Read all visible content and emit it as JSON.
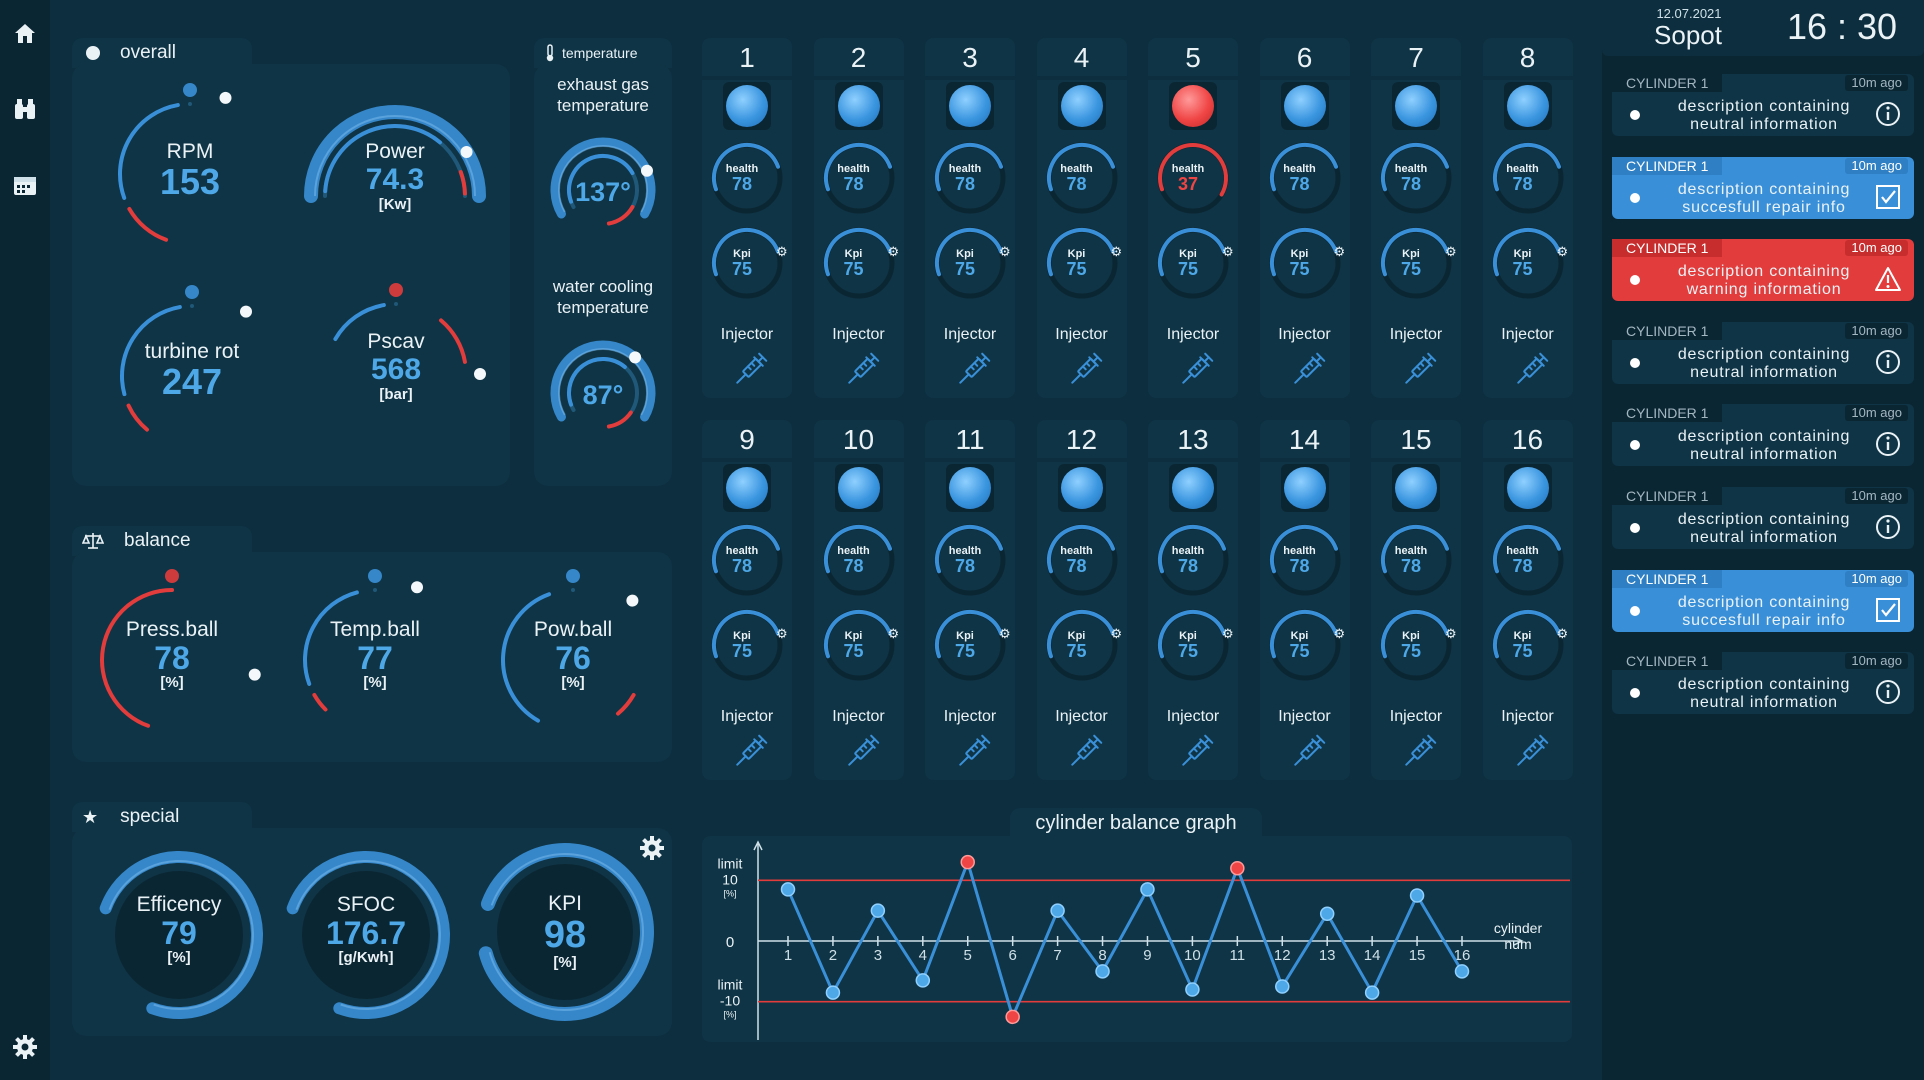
{
  "nav": {
    "icons": [
      "home-icon",
      "binoculars-icon",
      "calendar-icon",
      "settings-icon"
    ]
  },
  "overall": {
    "title": "overall",
    "rpm": {
      "label": "RPM",
      "value": "153",
      "level": 0.82
    },
    "power": {
      "label": "Power",
      "value": "74.3",
      "unit": "[Kw]",
      "level": 0.88
    },
    "turbine": {
      "label": "turbine rot",
      "value": "247",
      "level": 0.82
    },
    "pscav": {
      "label": "Pscav",
      "value": "568",
      "unit": "[bar]",
      "level": 0.88
    }
  },
  "temperature": {
    "title": "temperature",
    "exhaust": {
      "label_line1": "exhaust gas",
      "label_line2": "temperature",
      "value": "137°",
      "level": 0.86
    },
    "water": {
      "label_line1": "water cooling",
      "label_line2": "temperature",
      "value": "87°",
      "level": 0.8
    }
  },
  "balance": {
    "title": "balance",
    "press": {
      "label": "Press.ball",
      "value": "78",
      "unit": "[%]"
    },
    "temp": {
      "label": "Temp.ball",
      "value": "77",
      "unit": "[%]"
    },
    "pow": {
      "label": "Pow.ball",
      "value": "76",
      "unit": "[%]"
    }
  },
  "special": {
    "title": "special",
    "efficency": {
      "label": "Efficency",
      "value": "79",
      "unit": "[%]"
    },
    "sfoc": {
      "label": "SFOC",
      "value": "176.7",
      "unit": "[g/Kwh]"
    },
    "kpi": {
      "label": "KPI",
      "value": "98",
      "unit": "[%]"
    }
  },
  "cylinders": [
    {
      "num": "1",
      "health": "78",
      "kpi": "75",
      "status": "ok",
      "injector": "Injector"
    },
    {
      "num": "2",
      "health": "78",
      "kpi": "75",
      "status": "ok",
      "injector": "Injector"
    },
    {
      "num": "3",
      "health": "78",
      "kpi": "75",
      "status": "ok",
      "injector": "Injector"
    },
    {
      "num": "4",
      "health": "78",
      "kpi": "75",
      "status": "ok",
      "injector": "Injector"
    },
    {
      "num": "5",
      "health": "37",
      "kpi": "75",
      "status": "alarm",
      "injector": "Injector"
    },
    {
      "num": "6",
      "health": "78",
      "kpi": "75",
      "status": "ok",
      "injector": "Injector"
    },
    {
      "num": "7",
      "health": "78",
      "kpi": "75",
      "status": "ok",
      "injector": "Injector"
    },
    {
      "num": "8",
      "health": "78",
      "kpi": "75",
      "status": "ok",
      "injector": "Injector"
    },
    {
      "num": "9",
      "health": "78",
      "kpi": "75",
      "status": "ok",
      "injector": "Injector"
    },
    {
      "num": "10",
      "health": "78",
      "kpi": "75",
      "status": "ok",
      "injector": "Injector"
    },
    {
      "num": "11",
      "health": "78",
      "kpi": "75",
      "status": "ok",
      "injector": "Injector"
    },
    {
      "num": "12",
      "health": "78",
      "kpi": "75",
      "status": "ok",
      "injector": "Injector"
    },
    {
      "num": "13",
      "health": "78",
      "kpi": "75",
      "status": "ok",
      "injector": "Injector"
    },
    {
      "num": "14",
      "health": "78",
      "kpi": "75",
      "status": "ok",
      "injector": "Injector"
    },
    {
      "num": "15",
      "health": "78",
      "kpi": "75",
      "status": "ok",
      "injector": "Injector"
    },
    {
      "num": "16",
      "health": "78",
      "kpi": "75",
      "status": "ok",
      "injector": "Injector"
    }
  ],
  "mini_labels": {
    "health": "health",
    "kpi": "Kpi"
  },
  "chart_data": {
    "type": "line",
    "title": "cylinder balance graph",
    "x": [
      1,
      2,
      3,
      4,
      5,
      6,
      7,
      8,
      9,
      10,
      11,
      12,
      13,
      14,
      15,
      16
    ],
    "values": [
      8.5,
      -8.5,
      5,
      -6.5,
      13,
      -12.5,
      5,
      -5,
      8.5,
      -8,
      12,
      -7.5,
      4.5,
      -8.5,
      7.5,
      -5
    ],
    "ylim": [
      -15,
      15
    ],
    "limit_upper": {
      "label": "limit",
      "value": "10",
      "unit": "[%]",
      "y": 10
    },
    "limit_lower": {
      "label": "limit",
      "value": "-10",
      "unit": "[%]",
      "y": -10
    },
    "zero_label": "0",
    "xlabel_line1": "cylinder",
    "xlabel_line2": "num",
    "colors": {
      "line": "#3a90d8",
      "limit": "#e23c3c",
      "alarm": "#f04545"
    }
  },
  "header": {
    "date": "12.07.2021",
    "city": "Sopot",
    "time": "16 : 30"
  },
  "alerts": [
    {
      "cyl": "CYLINDER 1",
      "ago": "10m ago",
      "line1": "description containing",
      "line2": "neutral information",
      "type": "neutral"
    },
    {
      "cyl": "CYLINDER 1",
      "ago": "10m ago",
      "line1": "description containing",
      "line2": "succesfull repair info",
      "type": "repair"
    },
    {
      "cyl": "CYLINDER 1",
      "ago": "10m ago",
      "line1": "description containing",
      "line2": "warning information",
      "type": "warning"
    },
    {
      "cyl": "CYLINDER 1",
      "ago": "10m ago",
      "line1": "description containing",
      "line2": "neutral information",
      "type": "neutral"
    },
    {
      "cyl": "CYLINDER 1",
      "ago": "10m ago",
      "line1": "description containing",
      "line2": "neutral information",
      "type": "neutral"
    },
    {
      "cyl": "CYLINDER 1",
      "ago": "10m ago",
      "line1": "description containing",
      "line2": "neutral information",
      "type": "neutral"
    },
    {
      "cyl": "CYLINDER 1",
      "ago": "10m ago",
      "line1": "description containing",
      "line2": "succesfull repair info",
      "type": "repair"
    },
    {
      "cyl": "CYLINDER 1",
      "ago": "10m ago",
      "line1": "description containing",
      "line2": "neutral information",
      "type": "neutral"
    }
  ],
  "colors": {
    "bg": "#0d2e3e",
    "panel": "#0f3445",
    "blue": "#3a90d8",
    "red": "#e23c3c",
    "accent": "#4ea8e8"
  }
}
